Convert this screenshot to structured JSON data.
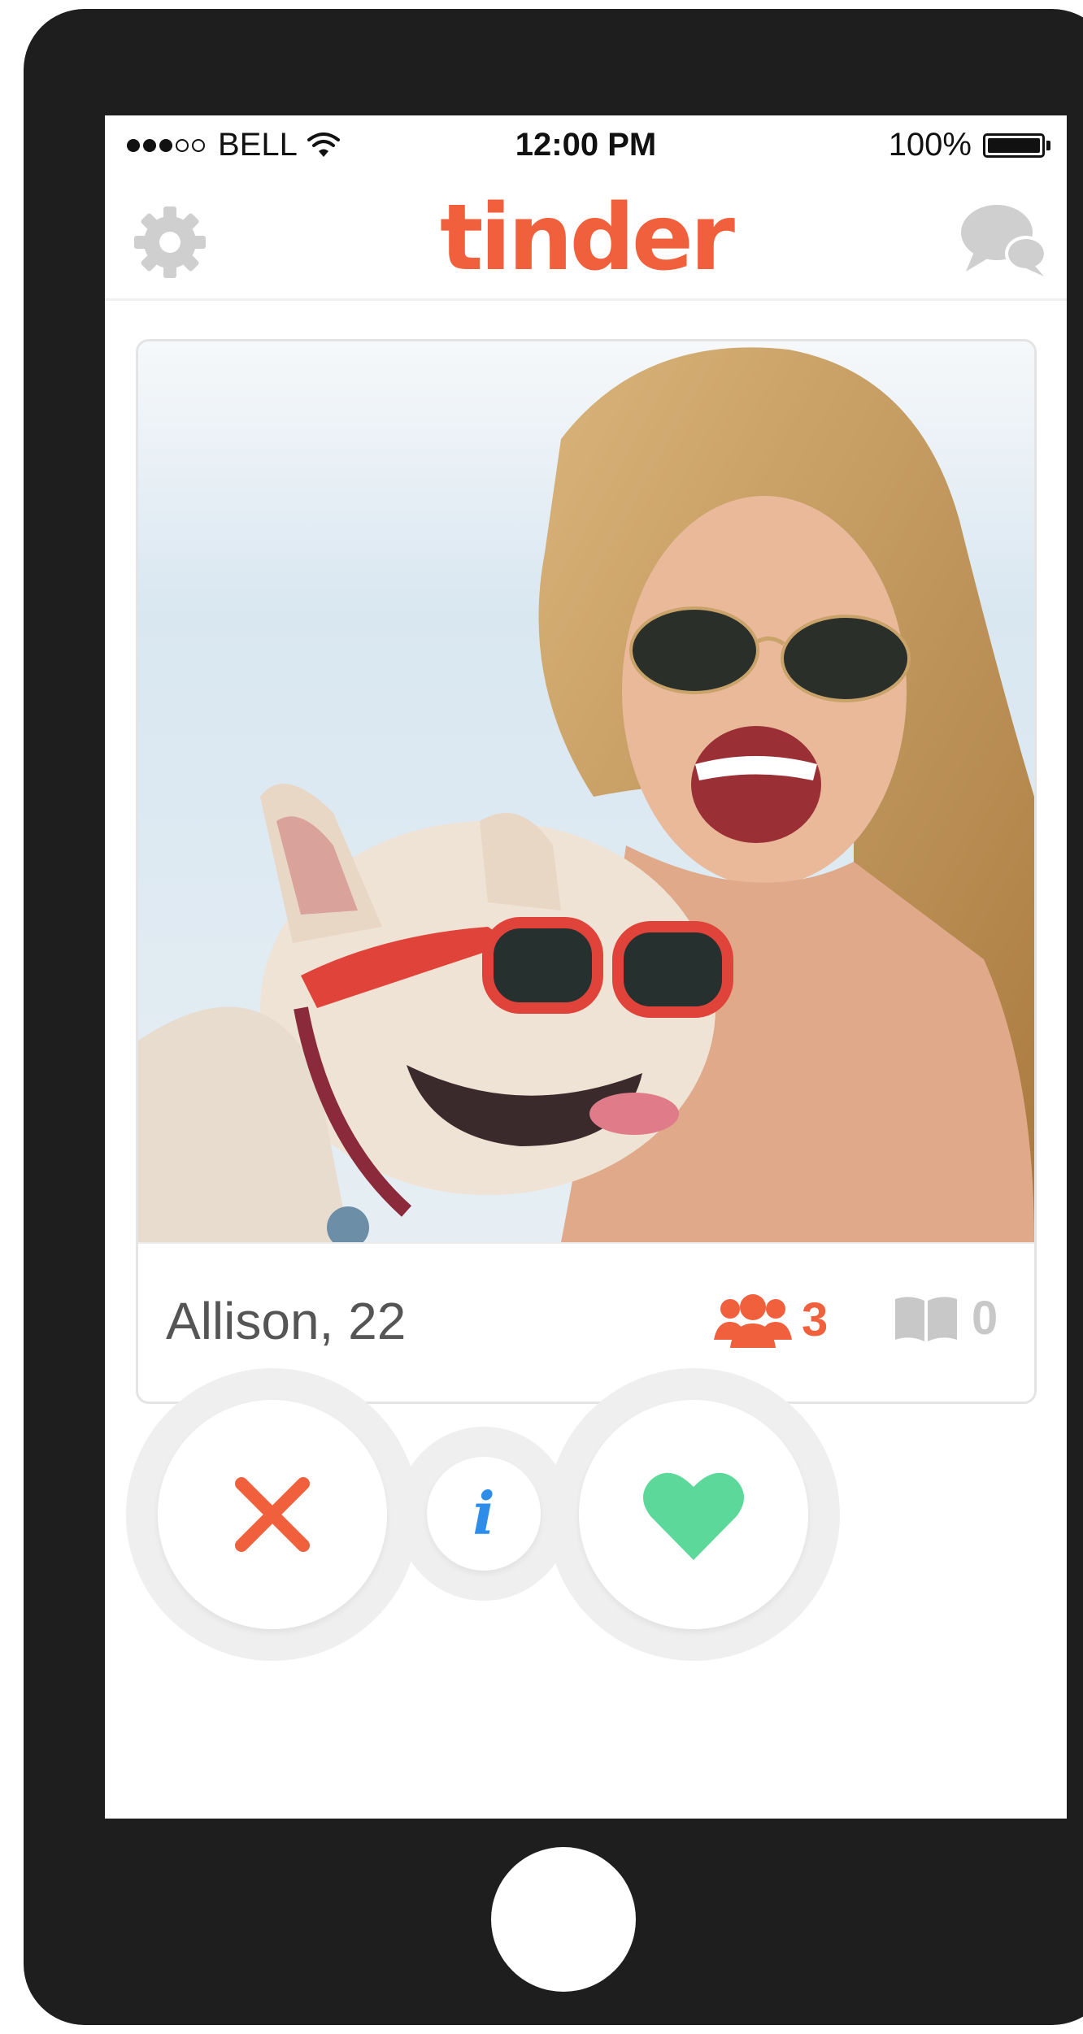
{
  "status_bar": {
    "carrier": "BELL",
    "time": "12:00 PM",
    "battery": "100%",
    "signal_bars_filled": 3,
    "signal_bars_total": 5
  },
  "nav": {
    "logo": "tinder",
    "left_icon": "gear-icon",
    "right_icon": "chat-bubbles-icon"
  },
  "profile": {
    "name_age": "Allison, 22",
    "common_friends": "3",
    "common_interests": "0"
  },
  "actions": {
    "nope_icon": "x-icon",
    "info_icon": "info-icon",
    "info_glyph": "i",
    "like_icon": "heart-icon"
  },
  "colors": {
    "brand": "#f0603c",
    "like": "#5cd89a",
    "info": "#2d8de8",
    "icon_gray": "#c8c8c8",
    "phone_body": "#1e1e1e"
  }
}
